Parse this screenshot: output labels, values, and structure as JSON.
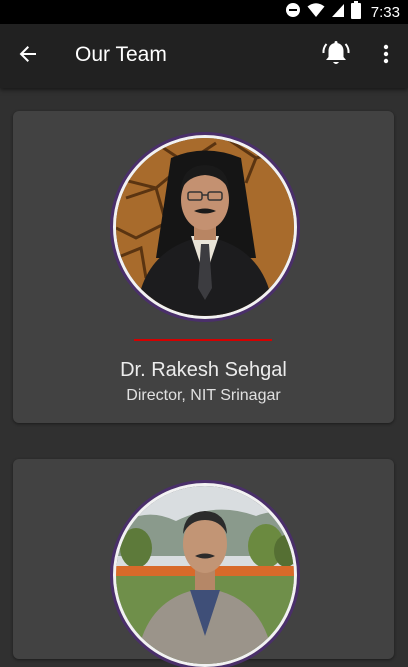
{
  "status_bar": {
    "time": "7:33",
    "icons": [
      "do-not-disturb-icon",
      "wifi-icon",
      "signal-icon",
      "battery-icon"
    ]
  },
  "app_bar": {
    "title": "Our Team",
    "back_icon": "arrow-back-icon",
    "notification_icon": "bell-ringing-icon",
    "menu_icon": "more-vert-icon"
  },
  "team": [
    {
      "name": "Dr. Rakesh Sehgal",
      "role": "Director, NIT Srinagar"
    },
    {
      "name": "",
      "role": ""
    }
  ],
  "colors": {
    "background": "#303030",
    "app_bar": "#212121",
    "card": "#424242",
    "divider_accent": "#d50000",
    "avatar_ring": "#4a2f6a"
  }
}
